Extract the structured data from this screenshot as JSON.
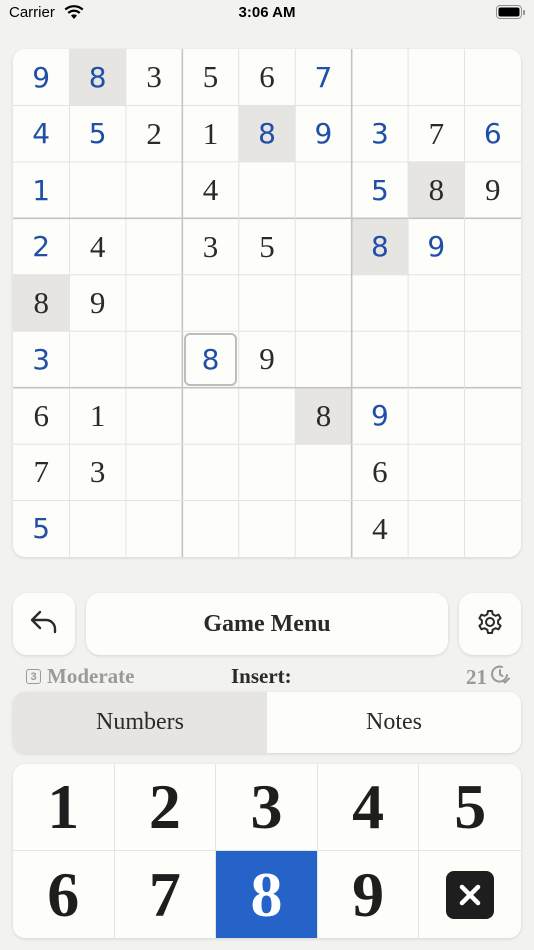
{
  "status_bar": {
    "carrier": "Carrier",
    "time": "3:06 AM"
  },
  "board": {
    "rows": [
      [
        "9",
        "8",
        "3",
        "5",
        "6",
        "7",
        "",
        "",
        ""
      ],
      [
        "4",
        "5",
        "2",
        "1",
        "8",
        "9",
        "3",
        "7",
        "6"
      ],
      [
        "1",
        "",
        "",
        "4",
        "",
        "",
        "5",
        "8",
        "9"
      ],
      [
        "2",
        "4",
        "",
        "3",
        "5",
        "",
        "8",
        "9",
        ""
      ],
      [
        "8",
        "9",
        "",
        "",
        "",
        "",
        "",
        "",
        ""
      ],
      [
        "3",
        "",
        "",
        "8",
        "9",
        "",
        "",
        "",
        ""
      ],
      [
        "6",
        "1",
        "",
        "",
        "",
        "8",
        "9",
        "",
        ""
      ],
      [
        "7",
        "3",
        "",
        "",
        "",
        "",
        "6",
        "",
        ""
      ],
      [
        "5",
        "",
        "",
        "",
        "",
        "",
        "4",
        "",
        ""
      ]
    ],
    "types": [
      [
        "p",
        "p",
        "g",
        "g",
        "g",
        "p",
        "",
        "",
        ""
      ],
      [
        "p",
        "p",
        "g",
        "g",
        "p",
        "p",
        "p",
        "g",
        "p"
      ],
      [
        "p",
        "",
        "",
        "g",
        "",
        "",
        "p",
        "g",
        "g"
      ],
      [
        "p",
        "g",
        "",
        "g",
        "g",
        "",
        "p",
        "p",
        ""
      ],
      [
        "g",
        "g",
        "",
        "",
        "",
        "",
        "",
        "",
        ""
      ],
      [
        "p",
        "",
        "",
        "p",
        "g",
        "",
        "",
        "",
        ""
      ],
      [
        "g",
        "g",
        "",
        "",
        "",
        "g",
        "p",
        "",
        ""
      ],
      [
        "g",
        "g",
        "",
        "",
        "",
        "",
        "g",
        "",
        ""
      ],
      [
        "p",
        "",
        "",
        "",
        "",
        "",
        "g",
        "",
        ""
      ]
    ],
    "highlighted": [
      [
        0,
        1
      ],
      [
        1,
        4
      ],
      [
        2,
        7
      ],
      [
        3,
        6
      ],
      [
        4,
        0
      ],
      [
        6,
        5
      ]
    ],
    "selected": [
      5,
      3
    ]
  },
  "controls": {
    "undo_icon": "undo-arrow-icon",
    "menu_label": "Game Menu",
    "settings_icon": "gear-icon"
  },
  "info": {
    "difficulty_badge": "3",
    "difficulty": "Moderate",
    "insert_label": "Insert:",
    "timer": "21",
    "timer_icon": "clock-check-icon"
  },
  "mode": {
    "tabs": [
      {
        "label": "Numbers",
        "active": true
      },
      {
        "label": "Notes",
        "active": false
      }
    ]
  },
  "keypad": {
    "keys": [
      "1",
      "2",
      "3",
      "4",
      "5",
      "6",
      "7",
      "8",
      "9"
    ],
    "active_key": "8",
    "erase_icon": "erase-x-icon"
  },
  "colors": {
    "player_digit": "#1f4fa8",
    "given_digit": "#2a2a2a",
    "highlight": "#e6e5e1",
    "accent": "#2563c9"
  }
}
